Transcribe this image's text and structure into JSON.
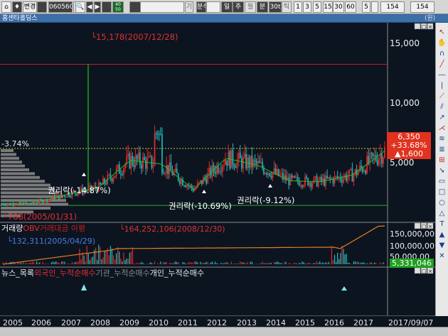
{
  "toolbar": {
    "items": [
      "⌂",
      "♦",
      "변경",
      "",
      "060560",
      "",
      "🔍",
      "◀",
      "▶",
      "",
      "40\n50",
      "홈센타홀딩스",
      "",
      "기",
      "분석",
      "",
      "일",
      "주",
      "월",
      "분",
      "30t",
      "틱",
      "1",
      "3",
      "5",
      "15",
      "30",
      "60",
      "5",
      "",
      "154",
      "154"
    ]
  },
  "window": {
    "title": "홈센타홀딩스",
    "close": "(원)"
  },
  "price_axis": {
    "labels": [
      "15,000",
      "10,000",
      "5,000"
    ]
  },
  "price_box": {
    "price": "6,350",
    "change": "+33.68%",
    "diff": "▲1,600"
  },
  "annotations": {
    "max": "15,178(2007/12/28)",
    "min": "788(2005/01/31)",
    "pct_line": "-3.74%",
    "r1": "권리락(-14.87%)",
    "r2": "권리락(-10.69%)",
    "r3": "권리락(-9.12%)"
  },
  "volume_panel": {
    "title_a": "거래량",
    "title_b": "OBV",
    "title_c": "거래대금 이평",
    "max": "164,252,106(2008/12/30)",
    "min": "132,311(2005/04/29)",
    "axis": [
      "150,000,00",
      "100,000,00",
      "50,000,00"
    ],
    "current": "5,331,046"
  },
  "investor_panel": {
    "labels": [
      "뉴스_목록",
      "외국인_누적순매수",
      "기관_누적순매수",
      "개인_누적순매수"
    ]
  },
  "x_axis": {
    "labels": [
      "2005",
      "2006",
      "2007",
      "2008",
      "2009",
      "2010",
      "2011",
      "2012",
      "2013",
      "2014",
      "2015",
      "2016",
      "2017"
    ],
    "current_date": "2017/09/07"
  },
  "chart_data": [
    {
      "type": "candlestick",
      "title": "홈센타홀딩스",
      "ylim": [
        0,
        16500
      ],
      "x": [
        "2005",
        "2006",
        "2007",
        "2008",
        "2009",
        "2010",
        "2011",
        "2012",
        "2013",
        "2014",
        "2015",
        "2016",
        "2017"
      ],
      "close": [
        900,
        1000,
        1900,
        2600,
        5400,
        5000,
        2400,
        5600,
        4900,
        3300,
        3200,
        3900,
        6350
      ],
      "max_point": {
        "value": 15178,
        "date": "2007/12/28"
      },
      "min_point": {
        "value": 788,
        "date": "2005/01/31"
      },
      "current": 6350
    },
    {
      "type": "bar",
      "title": "거래량",
      "series": [
        {
          "name": "OBV"
        }
      ],
      "max_point": {
        "value": 164252106,
        "date": "2008/12/30"
      },
      "min_point": {
        "value": 132311,
        "date": "2005/04/29"
      },
      "current": 5331046
    }
  ]
}
